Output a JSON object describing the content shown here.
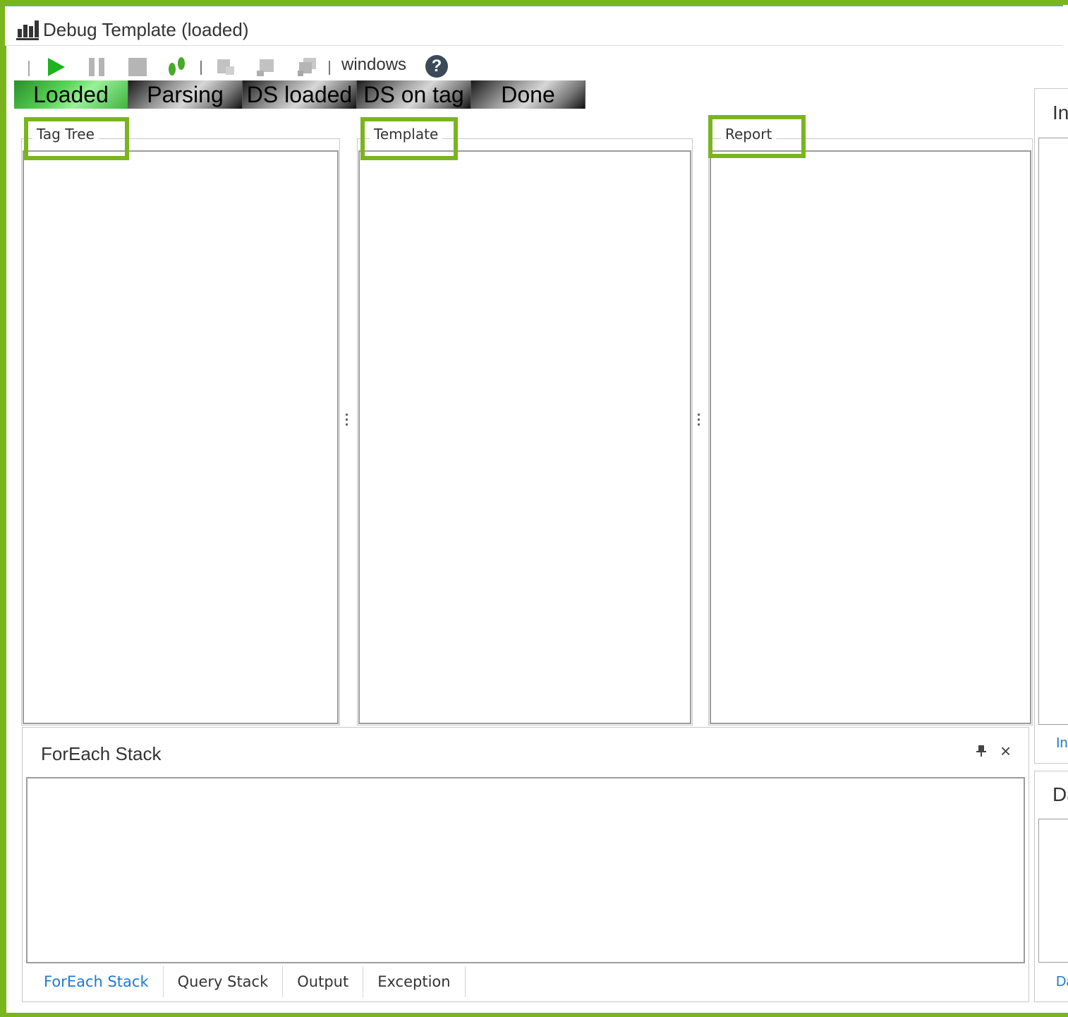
{
  "window": {
    "title": "Debug Template (loaded)"
  },
  "toolbar": {
    "windows_label": "windows",
    "help_label": "?",
    "icons": [
      "play-icon",
      "pause-icon",
      "stop-icon",
      "step-icon",
      "add-icon",
      "tag-icon",
      "stack-icon",
      "help-icon"
    ]
  },
  "steps": [
    {
      "label": "Loaded",
      "state": "active"
    },
    {
      "label": "Parsing",
      "state": "inactive"
    },
    {
      "label": "DS loaded",
      "state": "inactive"
    },
    {
      "label": "DS on tag",
      "state": "inactive"
    },
    {
      "label": "Done",
      "state": "inactive"
    }
  ],
  "panels": {
    "tag_tree": "Tag Tree",
    "template": "Template",
    "report": "Report"
  },
  "right_panels": {
    "top_title": "In",
    "top_link": "In",
    "bottom_title": "Da",
    "bottom_link": "Da"
  },
  "dock": {
    "title": "ForEach Stack",
    "pin": "📌",
    "close": "×",
    "tabs": [
      {
        "label": "ForEach Stack",
        "active": true
      },
      {
        "label": "Query Stack",
        "active": false
      },
      {
        "label": "Output",
        "active": false
      },
      {
        "label": "Exception",
        "active": false
      }
    ]
  },
  "colors": {
    "highlight": "#7ab51d",
    "link": "#1e7ad0",
    "play": "#1db31d"
  }
}
